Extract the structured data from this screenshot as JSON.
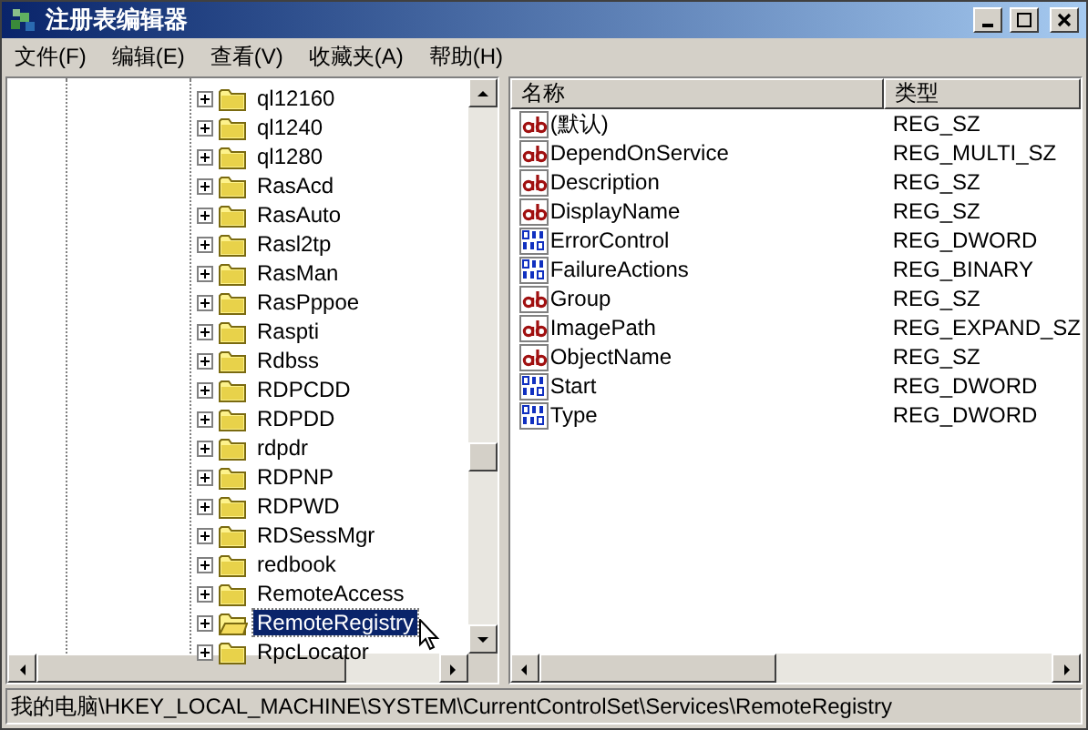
{
  "window": {
    "title": "注册表编辑器"
  },
  "menu": [
    "文件(F)",
    "编辑(E)",
    "查看(V)",
    "收藏夹(A)",
    "帮助(H)"
  ],
  "tree": {
    "items": [
      {
        "label": "ql12160",
        "selected": false
      },
      {
        "label": "ql1240",
        "selected": false
      },
      {
        "label": "ql1280",
        "selected": false
      },
      {
        "label": "RasAcd",
        "selected": false
      },
      {
        "label": "RasAuto",
        "selected": false
      },
      {
        "label": "Rasl2tp",
        "selected": false
      },
      {
        "label": "RasMan",
        "selected": false
      },
      {
        "label": "RasPppoe",
        "selected": false
      },
      {
        "label": "Raspti",
        "selected": false
      },
      {
        "label": "Rdbss",
        "selected": false
      },
      {
        "label": "RDPCDD",
        "selected": false
      },
      {
        "label": "RDPDD",
        "selected": false
      },
      {
        "label": "rdpdr",
        "selected": false
      },
      {
        "label": "RDPNP",
        "selected": false
      },
      {
        "label": "RDPWD",
        "selected": false
      },
      {
        "label": "RDSessMgr",
        "selected": false
      },
      {
        "label": "redbook",
        "selected": false
      },
      {
        "label": "RemoteAccess",
        "selected": false
      },
      {
        "label": "RemoteRegistry",
        "selected": true
      },
      {
        "label": "RpcLocator",
        "selected": false
      }
    ]
  },
  "values": {
    "columns": [
      "名称",
      "类型"
    ],
    "rows": [
      {
        "name": "(默认)",
        "type": "REG_SZ",
        "kind": "string"
      },
      {
        "name": "DependOnService",
        "type": "REG_MULTI_SZ",
        "kind": "string"
      },
      {
        "name": "Description",
        "type": "REG_SZ",
        "kind": "string"
      },
      {
        "name": "DisplayName",
        "type": "REG_SZ",
        "kind": "string"
      },
      {
        "name": "ErrorControl",
        "type": "REG_DWORD",
        "kind": "binary"
      },
      {
        "name": "FailureActions",
        "type": "REG_BINARY",
        "kind": "binary"
      },
      {
        "name": "Group",
        "type": "REG_SZ",
        "kind": "string"
      },
      {
        "name": "ImagePath",
        "type": "REG_EXPAND_SZ",
        "kind": "string"
      },
      {
        "name": "ObjectName",
        "type": "REG_SZ",
        "kind": "string"
      },
      {
        "name": "Start",
        "type": "REG_DWORD",
        "kind": "binary"
      },
      {
        "name": "Type",
        "type": "REG_DWORD",
        "kind": "binary"
      }
    ]
  },
  "status_bar": "我的电脑\\HKEY_LOCAL_MACHINE\\SYSTEM\\CurrentControlSet\\Services\\RemoteRegistry"
}
